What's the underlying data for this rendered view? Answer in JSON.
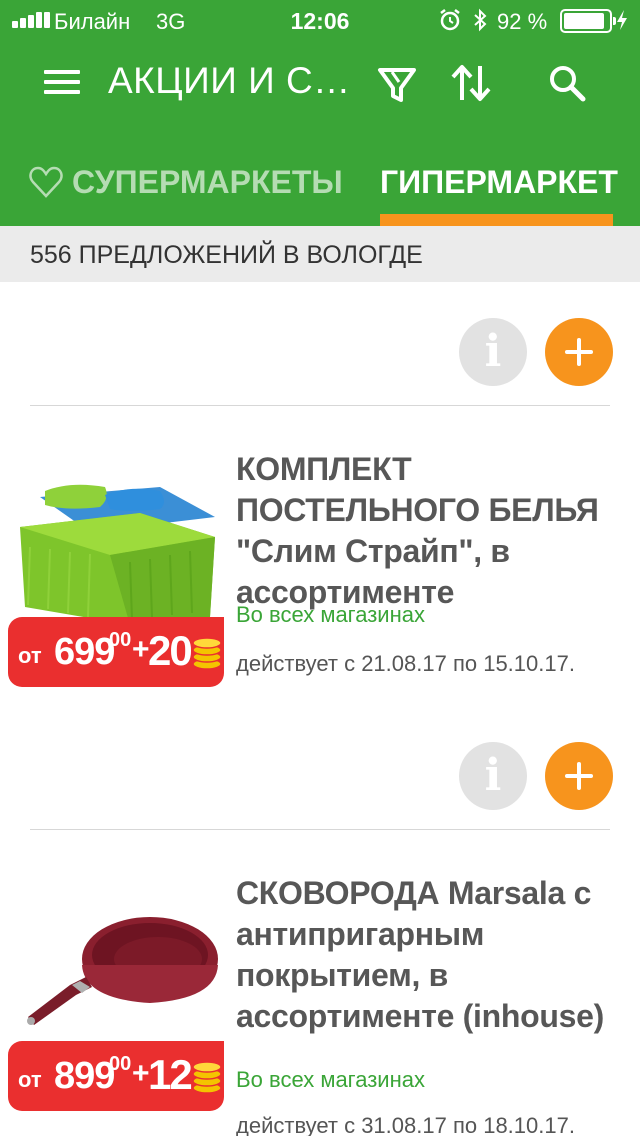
{
  "status_bar": {
    "carrier": "Билайн",
    "network": "3G",
    "time": "12:06",
    "battery": "92 %",
    "battery_level": 0.92
  },
  "header": {
    "title": "АКЦИИ И СК…",
    "icons": [
      "menu-icon",
      "filter-icon",
      "sort-icon",
      "search-icon"
    ]
  },
  "tabs": [
    {
      "label": "СУПЕРМАРКЕТЫ",
      "icon": "heart-icon",
      "active": false
    },
    {
      "label": "ГИПЕРМАРКЕТ",
      "active": true
    }
  ],
  "offers_count": "556 ПРЕДЛОЖЕНИЙ В ВОЛОГДЕ",
  "action_buttons": {
    "info_label": "i"
  },
  "products": [
    {
      "title": "КОМПЛЕКТ ПОСТЕЛЬНОГО БЕЛЬЯ \"Слим Страйп\", в ассортименте",
      "shops": "Во всех магазинах",
      "dates": "действует с 21.08.17 по 15.10.17.",
      "price_prefix": "от",
      "price_main": "699",
      "price_cents": "00",
      "plus": "+",
      "bonus": "20",
      "image": "bedding-set"
    },
    {
      "title": "СКОВОРОДА Marsala с антипригарным покрытием, в ассортименте (inhouse)",
      "shops": "Во всех магазинах",
      "dates": "действует с 31.08.17 по 18.10.17.",
      "price_prefix": "от",
      "price_main": "899",
      "price_cents": "00",
      "plus": "+",
      "bonus": "12",
      "image": "frying-pan"
    }
  ],
  "colors": {
    "header_green": "#3aa537",
    "accent_orange": "#f7941d",
    "price_red": "#ea2f2f",
    "shops_green": "#3aa537"
  }
}
